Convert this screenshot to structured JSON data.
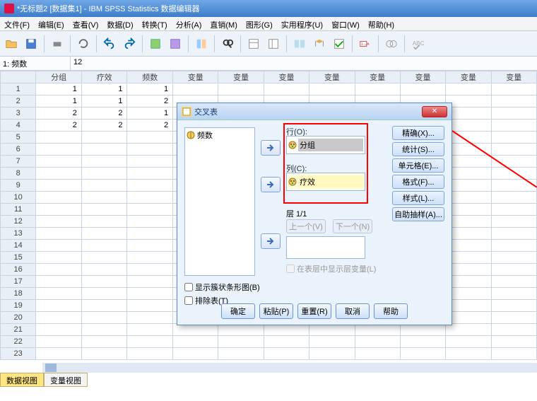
{
  "window": {
    "title": "*无标题2 [数据集1] - IBM SPSS Statistics 数据编辑器"
  },
  "menu": {
    "file": "文件(F)",
    "edit": "编辑(E)",
    "view": "查看(V)",
    "data": "数据(D)",
    "transform": "转换(T)",
    "analyze": "分析(A)",
    "direct": "直销(M)",
    "graphs": "图形(G)",
    "utilities": "实用程序(U)",
    "window": "窗口(W)",
    "help": "帮助(H)"
  },
  "formula": {
    "label": "1: 频数",
    "value": "12"
  },
  "columns": [
    "分组",
    "疗效",
    "频数",
    "变量",
    "变量",
    "变量",
    "变量",
    "变量",
    "变量",
    "变量",
    "变量"
  ],
  "rows": [
    {
      "n": "1",
      "c": [
        "1",
        "1",
        "1"
      ]
    },
    {
      "n": "2",
      "c": [
        "1",
        "1",
        "2"
      ]
    },
    {
      "n": "3",
      "c": [
        "2",
        "2",
        "1"
      ]
    },
    {
      "n": "4",
      "c": [
        "2",
        "2",
        "2"
      ]
    },
    {
      "n": "5"
    },
    {
      "n": "6"
    },
    {
      "n": "7"
    },
    {
      "n": "8"
    },
    {
      "n": "9"
    },
    {
      "n": "10"
    },
    {
      "n": "11"
    },
    {
      "n": "12"
    },
    {
      "n": "13"
    },
    {
      "n": "14"
    },
    {
      "n": "15"
    },
    {
      "n": "16"
    },
    {
      "n": "17"
    },
    {
      "n": "18"
    },
    {
      "n": "19"
    },
    {
      "n": "20"
    },
    {
      "n": "21"
    },
    {
      "n": "22"
    },
    {
      "n": "23"
    }
  ],
  "tabs": {
    "data": "数据视图",
    "var": "变量视图"
  },
  "dialog": {
    "title": "交叉表",
    "varlist": "频数",
    "row_label": "行(O):",
    "row_item": "分组",
    "col_label": "列(C):",
    "col_item": "疗效",
    "layer_label": "层 1/1",
    "prev": "上一个(V)",
    "next": "下一个(N)",
    "layer_check": "在表层中显示层变量(L)",
    "side": {
      "exact": "精确(X)...",
      "stats": "统计(S)...",
      "cells": "单元格(E)...",
      "format": "格式(F)...",
      "style": "样式(L)...",
      "bootstrap": "自助抽样(A)..."
    },
    "checks": {
      "bar": "显示簇状条形图(B)",
      "suppress": "排除表(T)"
    },
    "btns": {
      "ok": "确定",
      "paste": "粘贴(P)",
      "reset": "重置(R)",
      "cancel": "取消",
      "help": "帮助"
    }
  }
}
